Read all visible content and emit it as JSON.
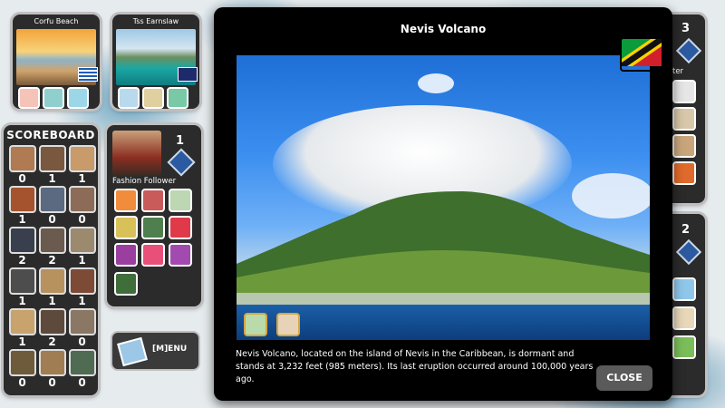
{
  "cards": [
    {
      "title": "Corfu Beach"
    },
    {
      "title": "Tss Earnslaw"
    }
  ],
  "scoreboard": {
    "title": "SCOREBOARD",
    "scores": [
      "0",
      "1",
      "1",
      "1",
      "0",
      "0",
      "2",
      "2",
      "1",
      "1",
      "1",
      "1",
      "1",
      "2",
      "0",
      "0",
      "0",
      "0"
    ]
  },
  "player": {
    "number": "1",
    "name": "Fashion Follower"
  },
  "right_panels": {
    "top_number": "3",
    "top_partial": "ter",
    "bottom_number": "2"
  },
  "modal": {
    "title": "Nevis Volcano",
    "description": "Nevis Volcano, located on the island of Nevis in the Caribbean, is dormant and stands at 3,232 feet (985 meters). Its last eruption occurred around 100,000 years ago.",
    "close_label": "CLOSE"
  },
  "menu": {
    "label": "[M]ENU"
  }
}
